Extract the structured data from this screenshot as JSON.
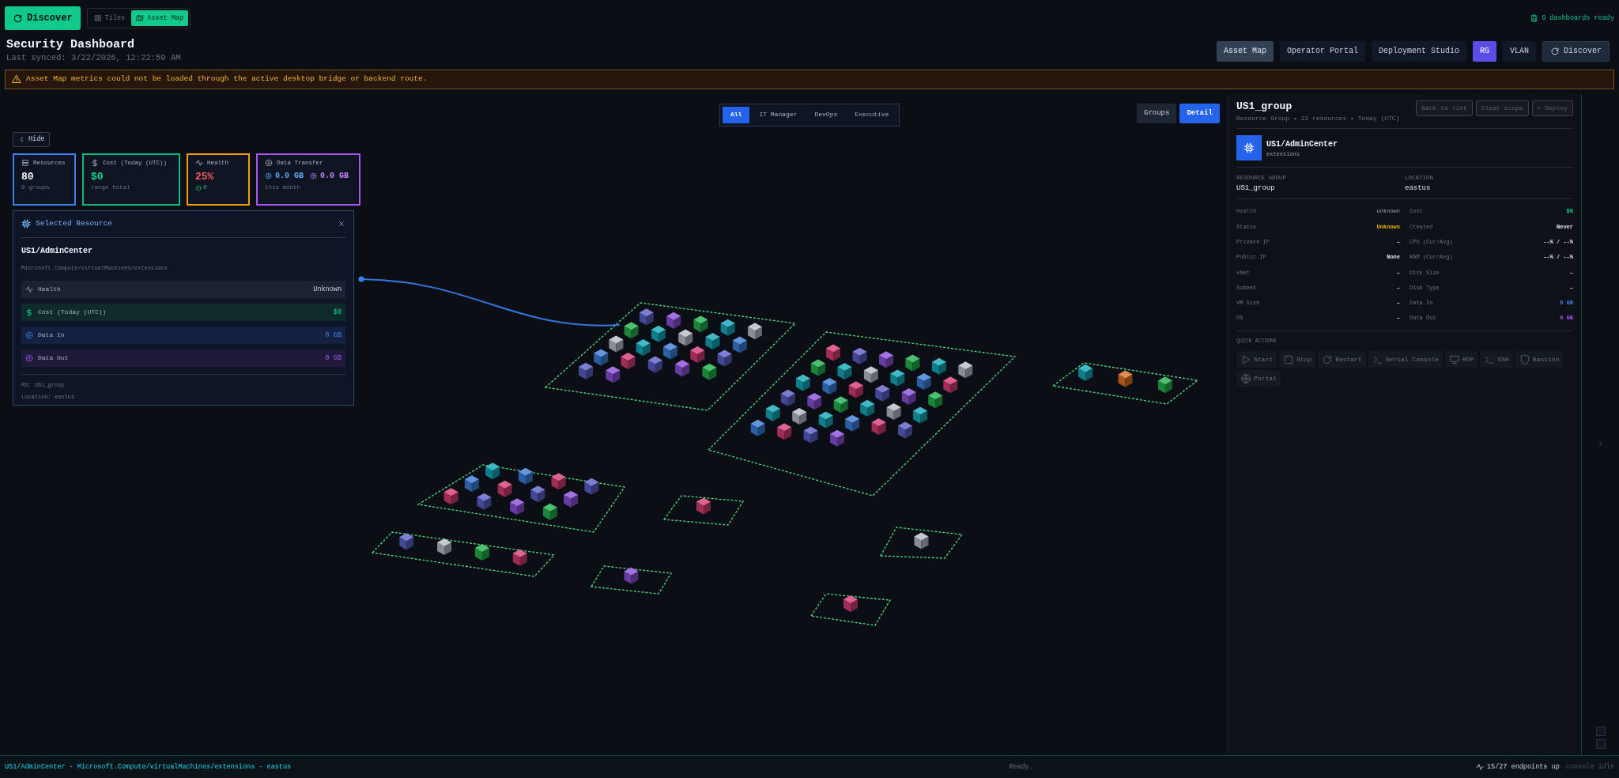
{
  "toolbar": {
    "discover_button": "Discover",
    "view_toggle": [
      {
        "label": "Tiles",
        "selected": false
      },
      {
        "label": "Asset Map",
        "selected": true
      }
    ],
    "status": "6 dashboards ready"
  },
  "header": {
    "title": "Security Dashboard",
    "subtitle": "Last synced: 3/22/2026, 12:22:59 AM"
  },
  "nav_buttons": [
    {
      "label": "Asset Map",
      "kind": "view",
      "selected": true
    },
    {
      "label": "Operator Portal",
      "kind": "view",
      "selected": false
    },
    {
      "label": "Deployment Studio",
      "kind": "view",
      "selected": false
    },
    {
      "label": "RG",
      "kind": "toggle",
      "selected": true
    },
    {
      "label": "VLAN",
      "kind": "toggle",
      "selected": false
    },
    {
      "label": "Discover",
      "kind": "action",
      "selected": false
    }
  ],
  "warning": "Asset Map metrics could not be loaded through the active desktop bridge or backend route.",
  "map": {
    "hide_button": "Hide",
    "role_filter": [
      {
        "label": "All",
        "selected": true
      },
      {
        "label": "IT Manager",
        "selected": false
      },
      {
        "label": "DevOps",
        "selected": false
      },
      {
        "label": "Executive",
        "selected": false
      }
    ],
    "view_mode": [
      {
        "label": "Groups",
        "selected": false
      },
      {
        "label": "Detail",
        "selected": true
      }
    ],
    "stats": [
      {
        "kind": "resources",
        "label": "Resources",
        "value": "80",
        "note": "9 groups",
        "color": "#3b82f6"
      },
      {
        "kind": "cost",
        "label": "Cost (Today (UTC))",
        "value": "$0",
        "note": "range total",
        "color": "#10b981"
      },
      {
        "kind": "health",
        "label": "Health",
        "value": "25%",
        "note": "0",
        "color": "#f59e0b"
      },
      {
        "kind": "transfer",
        "label": "Data Transfer",
        "in": "0.0 GB",
        "out": "0.0 GB",
        "note": "this month",
        "color": "#a855f7"
      }
    ],
    "selected_resource": {
      "title": "Selected Resource",
      "name": "US1/AdminCenter",
      "type": "Microsoft.Compute/virtualMachines/extensions",
      "metrics": [
        {
          "kind": "health",
          "label": "Health",
          "value": "Unknown"
        },
        {
          "kind": "cost",
          "label": "Cost (Today (UTC))",
          "value": "$0"
        },
        {
          "kind": "in",
          "label": "Data In",
          "value": "0 GB"
        },
        {
          "kind": "out",
          "label": "Data Out",
          "value": "0 GB"
        }
      ],
      "footer": [
        "RG: US1_group",
        "Location: eastus"
      ]
    }
  },
  "detail_panel": {
    "title": "US1_group",
    "subtitle": "Resource Group • 22 resources • Today (UTC)",
    "actions": [
      {
        "label": "Back to list",
        "disabled": true
      },
      {
        "label": "Clear scope",
        "disabled": true
      },
      {
        "label": "+ Deploy",
        "disabled": true
      }
    ],
    "resource": {
      "name": "US1/AdminCenter",
      "subtitle": "extensions"
    },
    "info": [
      {
        "label": "RESOURCE GROUP",
        "value": "US1_group"
      },
      {
        "label": "LOCATION",
        "value": "eastus"
      }
    ],
    "properties": [
      {
        "label": "Health",
        "value": "unknown",
        "kind": "muted"
      },
      {
        "label": "Cost",
        "value": "$0",
        "kind": "cost"
      },
      {
        "label": "Status",
        "value": "Unknown",
        "kind": "warning"
      },
      {
        "label": "Created",
        "value": "Never",
        "kind": "strong"
      },
      {
        "label": "Private IP",
        "value": "–",
        "kind": "strong"
      },
      {
        "label": "CPU (Cur/Avg)",
        "value": "--% / --%",
        "kind": "strong"
      },
      {
        "label": "Public IP",
        "value": "None",
        "kind": "strong"
      },
      {
        "label": "RAM (Cur/Avg)",
        "value": "--% / --%",
        "kind": "strong"
      },
      {
        "label": "vNet",
        "value": "–",
        "kind": "strong"
      },
      {
        "label": "Disk Size",
        "value": "–",
        "kind": "strong"
      },
      {
        "label": "Subnet",
        "value": "–",
        "kind": "strong"
      },
      {
        "label": "Disk Type",
        "value": "–",
        "kind": "strong"
      },
      {
        "label": "VM Size",
        "value": "–",
        "kind": "strong"
      },
      {
        "label": "Data In",
        "value": "0 GB",
        "kind": "in"
      },
      {
        "label": "OS",
        "value": "–",
        "kind": "strong"
      },
      {
        "label": "Data Out",
        "value": "0 GB",
        "kind": "out"
      }
    ],
    "quick_actions_title": "QUICK ACTIONS",
    "quick_actions": [
      {
        "kind": "start",
        "label": "Start"
      },
      {
        "kind": "stop",
        "label": "Stop"
      },
      {
        "kind": "restart",
        "label": "Restart"
      },
      {
        "kind": "serial",
        "label": "Serial Console"
      },
      {
        "kind": "rdp",
        "label": "RDP"
      },
      {
        "kind": "ssh",
        "label": "SSH"
      },
      {
        "kind": "bastion",
        "label": "Bastion"
      },
      {
        "kind": "portal",
        "label": "Portal"
      }
    ]
  },
  "status_bar": {
    "selection": "US1/AdminCenter - Microsoft.Compute/virtualMachines/extensions - eastus",
    "state": "Ready.",
    "endpoints": "15/27 endpoints up",
    "console": "console idle"
  }
}
